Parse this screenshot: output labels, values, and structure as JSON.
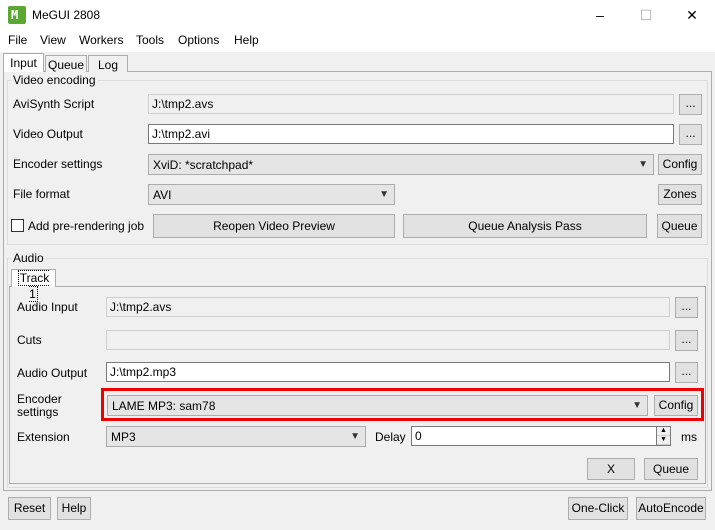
{
  "window": {
    "title": "MeGUI 2808",
    "app_icon_glyph": "M",
    "minimize": "–",
    "maximize": "☐",
    "close": "✕"
  },
  "menu": [
    "File",
    "View",
    "Workers",
    "Tools",
    "Options",
    "Help"
  ],
  "main_tabs": [
    "Input",
    "Queue",
    "Log"
  ],
  "video": {
    "group_title": "Video encoding",
    "avisynth_label": "AviSynth Script",
    "avisynth_value": "J:\\tmp2.avs",
    "output_label": "Video Output",
    "output_value": "J:\\tmp2.avi",
    "encoder_label": "Encoder settings",
    "encoder_value": "XviD: *scratchpad*",
    "config_label": "Config",
    "format_label": "File format",
    "format_value": "AVI",
    "zones_label": "Zones",
    "prerender_label": "Add pre-rendering job",
    "reopen_label": "Reopen Video Preview",
    "analysis_label": "Queue Analysis Pass",
    "queue_label": "Queue",
    "browse_label": "..."
  },
  "audio": {
    "group_title": "Audio",
    "track_tab": "Track 1",
    "input_label": "Audio Input",
    "input_value": "J:\\tmp2.avs",
    "cuts_label": "Cuts",
    "cuts_value": "",
    "output_label": "Audio Output",
    "output_value": "J:\\tmp2.mp3",
    "encoder_label_1": "Encoder",
    "encoder_label_2": "settings",
    "encoder_value": "LAME MP3: sam78",
    "config_label": "Config",
    "extension_label": "Extension",
    "extension_value": "MP3",
    "delay_label": "Delay",
    "delay_value": "0",
    "ms_label": "ms",
    "x_label": "X",
    "queue_label": "Queue",
    "browse_label": "..."
  },
  "bottom": {
    "reset": "Reset",
    "help": "Help",
    "one_click": "One-Click",
    "auto_encode": "AutoEncode"
  },
  "colors": {
    "highlight": "#e00000",
    "icon": "#5aa832"
  }
}
